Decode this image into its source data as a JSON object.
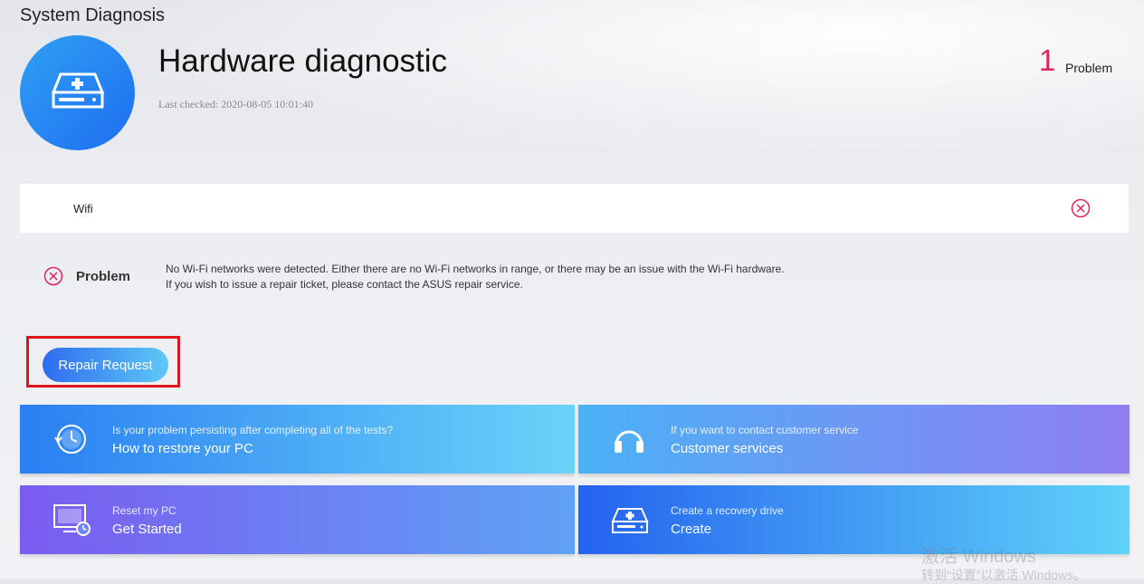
{
  "window": {
    "title": "System Diagnosis"
  },
  "header": {
    "icon": "hard-drive-medical-icon",
    "title": "Hardware diagnostic",
    "last_checked": "Last checked: 2020-08-05 10:01:40",
    "problem_count": "1",
    "problem_count_label": "Problem"
  },
  "test_item": {
    "name": "Wifi",
    "status_icon": "fail-circle-x-icon",
    "status_color": "#e0245e"
  },
  "problem": {
    "label": "Problem",
    "line1": "No Wi-Fi networks were detected. Either there are no Wi-Fi networks in range, or there may be an issue with the Wi-Fi hardware.",
    "line2": "If you wish to issue a repair ticket, please contact the ASUS repair service."
  },
  "repair_button": {
    "label": "Repair Request"
  },
  "cards": [
    {
      "icon": "clock-restore-icon",
      "subtitle": "Is your problem persisting after completing all of the tests?",
      "title": "How to restore your PC"
    },
    {
      "icon": "headset-icon",
      "subtitle": "If you want to contact customer service",
      "title": "Customer services"
    },
    {
      "icon": "monitor-reset-icon",
      "subtitle": "Reset my PC",
      "title": "Get Started"
    },
    {
      "icon": "drive-icon",
      "subtitle": "Create a recovery drive",
      "title": "Create"
    }
  ],
  "watermark": {
    "line1": "激活 Windows",
    "line2": "转到“设置”以激活 Windows。"
  },
  "colors": {
    "accent": "#1e6ef0",
    "problem": "#e0245e",
    "highlight": "#e0141e"
  }
}
